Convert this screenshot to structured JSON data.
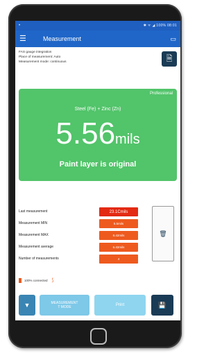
{
  "device": {
    "home_icon": "home-button"
  },
  "status_bar": {
    "left_icon": "•",
    "right_text": "✱ ᯤ ◢ 100% 08:01"
  },
  "app_bar": {
    "menu_icon": "☰",
    "title": "Measurement",
    "cast_icon": "▭"
  },
  "info": {
    "lines": [
      "FAS gauge integration",
      "Place of measurement: Auto",
      "Measurement mode: continuous"
    ],
    "pdf_icon": "🗎"
  },
  "gauge": {
    "color": "#52c46a",
    "mode_label": "Professional",
    "material": "Steel (Fe) + Zinc (Zn)",
    "value": "5.56",
    "unit": "mils",
    "status": "Paint layer is original"
  },
  "stats": {
    "rows": [
      {
        "label": "Last measurement",
        "value": "23.1Cmils"
      },
      {
        "label": "Measurement MIN",
        "value": "5.5mils"
      },
      {
        "label": "Measurement MAX",
        "value": "8.42mils"
      },
      {
        "label": "Measurement average",
        "value": "6.42mils"
      },
      {
        "label": "Number of measurements",
        "value": "4"
      }
    ],
    "trash_icon": "🗑"
  },
  "connection": {
    "text": "100% connected",
    "signal_icon": "⟆"
  },
  "actions": {
    "down_icon": "▼",
    "mode_label_1": "MEASUREMENT",
    "mode_label_2": "T MODE",
    "print_label": "Print",
    "save_icon": "💾"
  }
}
